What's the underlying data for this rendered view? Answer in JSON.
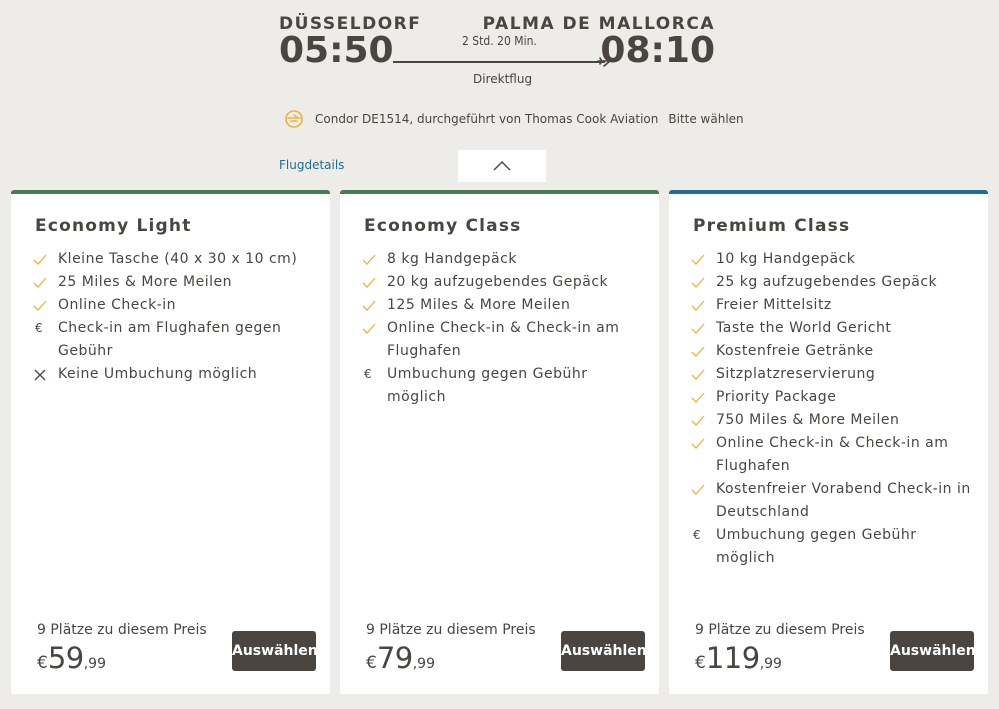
{
  "flight": {
    "origin": "DÜSSELDORF",
    "destination": "PALMA DE MALLORCA",
    "departure_time": "05:50",
    "arrival_time": "08:10",
    "duration": "2 Std. 20 Min.",
    "stops": "Direktflug",
    "carrier_text": "Condor DE1514, durchgeführt von Thomas Cook Aviation",
    "choose_text": "Bitte wählen",
    "details_link": "Flugdetails"
  },
  "colors": {
    "economy_accent": "#4a7a54",
    "premium_accent": "#1d6f8d",
    "check_icon": "#e8b440",
    "button_bg": "#4a4540",
    "link": "#1e6f8e",
    "page_bg": "#eeece8"
  },
  "fares": [
    {
      "name": "Economy Light",
      "features": [
        {
          "icon": "check-icon",
          "text": "Kleine Tasche (40 x 30 x 10 cm)"
        },
        {
          "icon": "check-icon",
          "text": "25 Miles & More Meilen"
        },
        {
          "icon": "check-icon",
          "text": "Online Check-in"
        },
        {
          "icon": "euro-icon",
          "text": "Check-in am Flughafen gegen Gebühr"
        },
        {
          "icon": "cross-icon",
          "text": "Keine Umbuchung möglich"
        }
      ],
      "seats": "9 Plätze zu diesem Preis",
      "currency": "€",
      "price_int": "59",
      "price_dec": ",99",
      "button": "Auswählen"
    },
    {
      "name": "Economy Class",
      "features": [
        {
          "icon": "check-icon",
          "text": "8 kg Handgepäck"
        },
        {
          "icon": "check-icon",
          "text": "20 kg aufzugebendes Gepäck"
        },
        {
          "icon": "check-icon",
          "text": "125 Miles & More Meilen"
        },
        {
          "icon": "check-icon",
          "text": "Online Check-in & Check-in am Flughafen"
        },
        {
          "icon": "euro-icon",
          "text": "Umbuchung gegen Gebühr möglich"
        }
      ],
      "seats": "9 Plätze zu diesem Preis",
      "currency": "€",
      "price_int": "79",
      "price_dec": ",99",
      "button": "Auswählen"
    },
    {
      "name": "Premium Class",
      "features": [
        {
          "icon": "check-icon",
          "text": "10 kg Handgepäck"
        },
        {
          "icon": "check-icon",
          "text": "25 kg aufzugebendes Gepäck"
        },
        {
          "icon": "check-icon",
          "text": "Freier Mittelsitz"
        },
        {
          "icon": "check-icon",
          "text": "Taste the World Gericht"
        },
        {
          "icon": "check-icon",
          "text": "Kostenfreie Getränke"
        },
        {
          "icon": "check-icon",
          "text": "Sitzplatzreservierung"
        },
        {
          "icon": "check-icon",
          "text": "Priority Package"
        },
        {
          "icon": "check-icon",
          "text": "750 Miles & More Meilen"
        },
        {
          "icon": "check-icon",
          "text": "Online Check-in & Check-in am Flughafen"
        },
        {
          "icon": "check-icon",
          "text": "Kostenfreier Vorabend Check-in in Deutschland"
        },
        {
          "icon": "euro-icon",
          "text": "Umbuchung gegen Gebühr möglich"
        }
      ],
      "seats": "9 Plätze zu diesem Preis",
      "currency": "€",
      "price_int": "119",
      "price_dec": ",99",
      "button": "Auswählen"
    }
  ]
}
